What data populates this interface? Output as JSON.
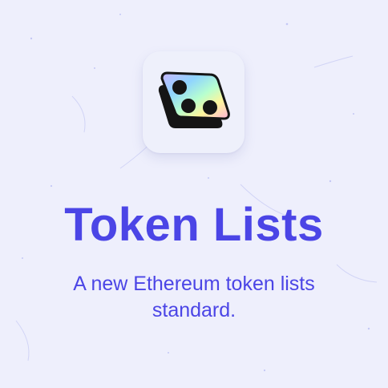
{
  "hero": {
    "logo_icon": "token-lists-logo-icon",
    "title": "Token Lists",
    "subtitle": "A new Ethereum token lists standard."
  },
  "colors": {
    "background": "#eeeffc",
    "accent": "#4b45e6",
    "tile": "#eef0fb"
  }
}
